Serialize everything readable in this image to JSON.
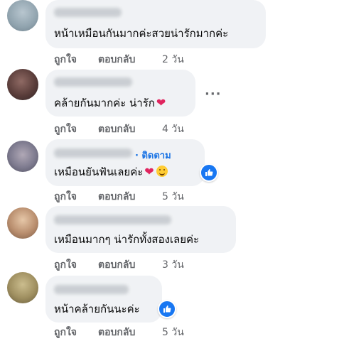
{
  "comments": [
    {
      "text": "หน้าเหมือนกันมากค่ะสวยน่ารักมากค่ะ",
      "like_label": "ถูกใจ",
      "reply_label": "ตอบกลับ",
      "time": "2 วัน"
    },
    {
      "text": "คล้ายกันมากค่ะ น่ารัก",
      "emoji": "❤",
      "like_label": "ถูกใจ",
      "reply_label": "ตอบกลับ",
      "time": "4 วัน",
      "more_label": "···"
    },
    {
      "text": "เหมือนยันฟันเลยค่ะ",
      "emoji": "❤",
      "follow_label": "· ติดตาม",
      "like_label": "ถูกใจ",
      "reply_label": "ตอบกลับ",
      "time": "5 วัน"
    },
    {
      "text": "เหมือนมากๆ น่ารักทั้งสองเลยค่ะ",
      "like_label": "ถูกใจ",
      "reply_label": "ตอบกลับ",
      "time": "3 วัน"
    },
    {
      "text": "หน้าคล้ายกันนะค่ะ",
      "like_label": "ถูกใจ",
      "reply_label": "ตอบกลับ",
      "time": "5 วัน"
    }
  ],
  "colors": {
    "bubble": "#f0f2f5",
    "text": "#050505",
    "secondary": "#65676b",
    "accent": "#1b74e4",
    "like_badge": "#1877f2",
    "heart": "#e0245e"
  },
  "icons": [
    "heart-emoji-icon",
    "smile-emoji-icon",
    "like-reaction-icon",
    "more-options-icon"
  ]
}
